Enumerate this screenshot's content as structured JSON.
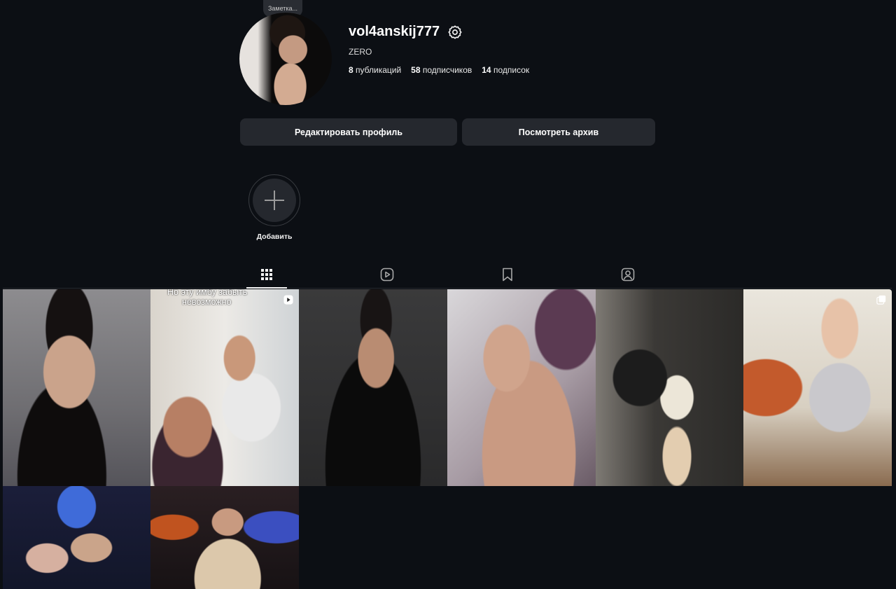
{
  "note": {
    "text": "Заметка..."
  },
  "profile": {
    "username": "vol4anskij777",
    "bio": "ZERO",
    "stats": [
      {
        "value": "8",
        "label": "публикаций"
      },
      {
        "value": "58",
        "label": "подписчиков"
      },
      {
        "value": "14",
        "label": "подписок"
      }
    ]
  },
  "actions": {
    "edit_label": "Редактировать профиль",
    "archive_label": "Посмотреть архив"
  },
  "highlights": {
    "add_label": "Добавить"
  },
  "tabs": [
    {
      "icon": "grid-icon",
      "active": true
    },
    {
      "icon": "reels-icon",
      "active": false
    },
    {
      "icon": "saved-icon",
      "active": false
    },
    {
      "icon": "tagged-icon",
      "active": false
    }
  ],
  "posts": [
    {
      "type": "photo"
    },
    {
      "type": "reel",
      "overlay_line1": "Но эту имбу забыть",
      "overlay_line2": "невозможно"
    },
    {
      "type": "photo"
    },
    {
      "type": "photo"
    },
    {
      "type": "photo"
    },
    {
      "type": "carousel"
    },
    {
      "type": "photo"
    },
    {
      "type": "photo"
    }
  ],
  "colors": {
    "background": "#0c0f14",
    "button": "#25282e",
    "text": "#f5f5f5"
  }
}
